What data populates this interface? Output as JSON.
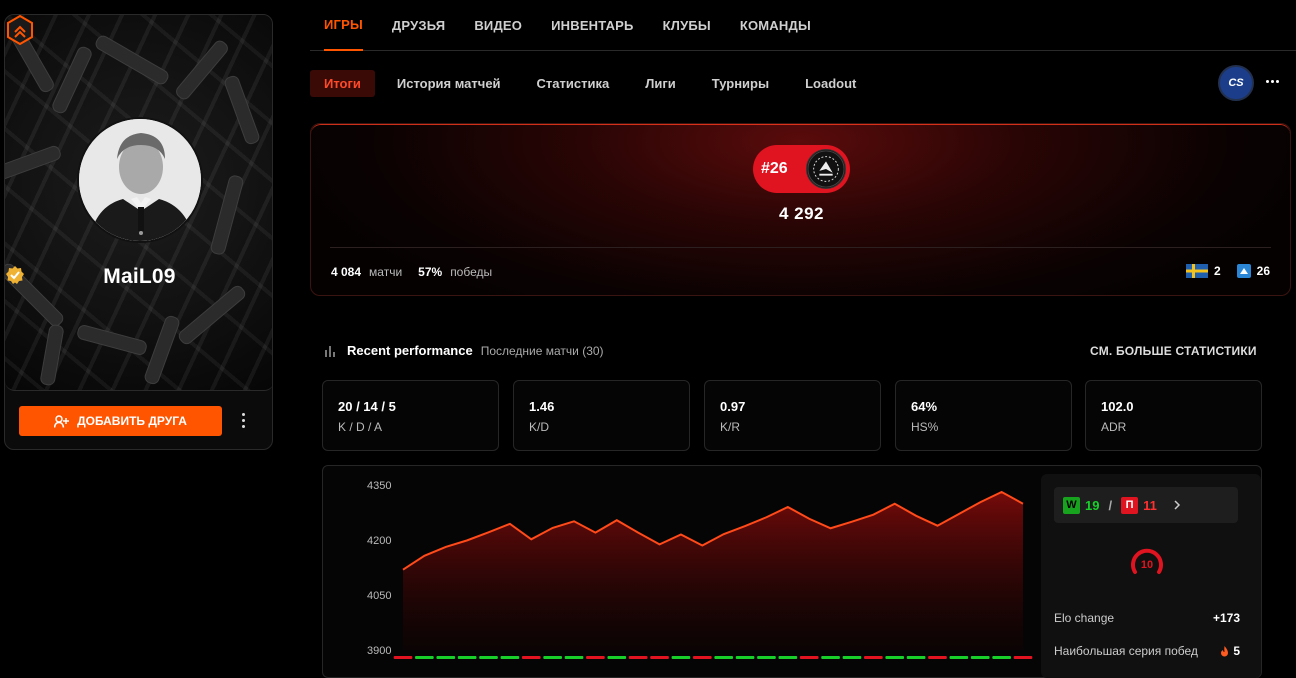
{
  "profile": {
    "username": "MaiL09",
    "add_friend_label": "ДОБАВИТЬ ДРУГА"
  },
  "top_nav": [
    "ИГРЫ",
    "ДРУЗЬЯ",
    "ВИДЕО",
    "ИНВЕНТАРЬ",
    "КЛУБЫ",
    "КОМАНДЫ"
  ],
  "sub_nav": [
    "Итоги",
    "История матчей",
    "Статистика",
    "Лиги",
    "Турниры",
    "Loadout"
  ],
  "game_logo": "CS",
  "elo_panel": {
    "rank": "#26",
    "elo": "4 292",
    "matches_value": "4 084",
    "matches_label": "матчи",
    "wins_value": "57%",
    "wins_label": "победы",
    "country_rank": "2",
    "region_rank": "26"
  },
  "performance": {
    "title": "Recent performance",
    "subtitle": "Последние матчи (30)",
    "see_more": "СМ. БОЛЬШЕ СТАТИСТИКИ",
    "cards": [
      {
        "value": "20 / 14 / 5",
        "label": "K / D / A"
      },
      {
        "value": "1.46",
        "label": "K/D"
      },
      {
        "value": "0.97",
        "label": "K/R"
      },
      {
        "value": "64%",
        "label": "HS%"
      },
      {
        "value": "102.0",
        "label": "ADR"
      }
    ]
  },
  "side_panel": {
    "wins_badge": "W",
    "wins": "19",
    "separator": "/",
    "losses_badge": "П",
    "losses": "11",
    "level": "10",
    "elo_change_label": "Elo change",
    "elo_change_value": "+173",
    "streak_label": "Наибольшая серия побед",
    "streak_value": "5"
  },
  "colors": {
    "accent": "#ff5500",
    "win": "#17d12a",
    "loss": "#e01320"
  },
  "chart_data": {
    "type": "area",
    "ylim": [
      3900,
      4350
    ],
    "yticks": [
      "4350",
      "4200",
      "4050",
      "3900"
    ],
    "values": [
      4119,
      4157,
      4181,
      4199,
      4221,
      4244,
      4202,
      4233,
      4251,
      4220,
      4254,
      4220,
      4188,
      4215,
      4185,
      4216,
      4238,
      4262,
      4290,
      4258,
      4232,
      4250,
      4269,
      4299,
      4266,
      4239,
      4271,
      4303,
      4331,
      4299
    ],
    "results": [
      "L",
      "W",
      "W",
      "W",
      "W",
      "W",
      "L",
      "W",
      "W",
      "L",
      "W",
      "L",
      "L",
      "W",
      "L",
      "W",
      "W",
      "W",
      "W",
      "L",
      "W",
      "W",
      "L",
      "W",
      "W",
      "L",
      "W",
      "W",
      "W",
      "L"
    ]
  }
}
